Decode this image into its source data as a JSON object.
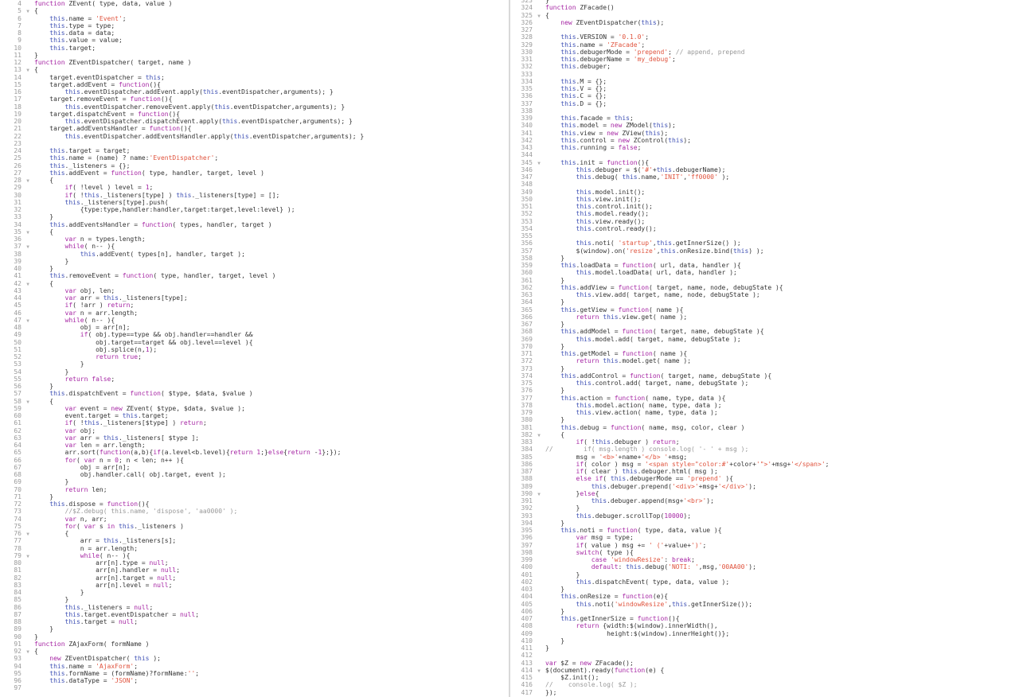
{
  "panes": [
    {
      "id": "left",
      "start": 0,
      "lines": [
        "4|function ZEvent( type, data, value )",
        "5|{",
        "6|    this.name = 'Event';",
        "7|    this.type = type;",
        "8|    this.data = data;",
        "9|    this.value = value;",
        "10|    this.target;",
        "11|}",
        "12|function ZEventDispatcher( target, name )",
        "13|{",
        "14|    target.eventDispatcher = this;",
        "15|    target.addEvent = function(){",
        "16|        this.eventDispatcher.addEvent.apply(this.eventDispatcher,arguments); }",
        "17|    target.removeEvent = function(){",
        "18|        this.eventDispatcher.removeEvent.apply(this.eventDispatcher,arguments); }",
        "19|    target.dispatchEvent = function(){",
        "20|        this.eventDispatcher.dispatchEvent.apply(this.eventDispatcher,arguments); }",
        "21|    target.addEventsHandler = function(){",
        "22|        this.eventDispatcher.addEventsHandler.apply(this.eventDispatcher,arguments); }",
        "23|",
        "24|    this.target = target;",
        "25|    this.name = (name) ? name:'EventDispatcher';",
        "26|    this._listeners = {};",
        "27|    this.addEvent = function( type, handler, target, level )",
        "28|    {",
        "29|        if( !level ) level = 1;",
        "30|        if( !this._listeners[type] ) this._listeners[type] = [];",
        "31|        this._listeners[type].push(",
        "32|            {type:type,handler:handler,target:target,level:level} );",
        "33|    }",
        "34|    this.addEventsHandler = function( types, handler, target )",
        "35|    {",
        "36|        var n = types.length;",
        "37|        while( n-- ){",
        "38|            this.addEvent( types[n], handler, target );",
        "39|        }",
        "40|    }",
        "41|    this.removeEvent = function( type, handler, target, level )",
        "42|    {",
        "43|        var obj, len;",
        "44|        var arr = this._listeners[type];",
        "45|        if( !arr ) return;",
        "46|        var n = arr.length;",
        "47|        while( n-- ){",
        "48|            obj = arr[n];",
        "49|            if( obj.type==type && obj.handler==handler &&",
        "50|                obj.target==target && obj.level==level ){",
        "51|                obj.splice(n,1);",
        "52|                return true;",
        "53|            }",
        "54|        }",
        "55|        return false;",
        "56|    }",
        "57|    this.dispatchEvent = function( $type, $data, $value )",
        "58|    {",
        "59|        var event = new ZEvent( $type, $data, $value );",
        "60|        event.target = this.target;",
        "61|        if( !this._listeners[$type] ) return;",
        "62|        var obj;",
        "63|        var arr = this._listeners[ $type ];",
        "64|        var len = arr.length;",
        "65|        arr.sort(function(a,b){if(a.level<b.level){return 1;}else{return -1};});",
        "66|        for( var n = 0; n < len; n++ ){",
        "67|            obj = arr[n];",
        "68|            obj.handler.call( obj.target, event );",
        "69|        }",
        "70|        return len;",
        "71|    }",
        "72|    this.dispose = function(){",
        "73|        //$Z.debug( this.name, 'dispose', 'aa0000' );",
        "74|        var n, arr;",
        "75|        for( var s in this._listeners )",
        "76|        {",
        "77|            arr = this._listeners[s];",
        "78|            n = arr.length;",
        "79|            while( n-- ){",
        "80|                arr[n].type = null;",
        "81|                arr[n].handler = null;",
        "82|                arr[n].target = null;",
        "83|                arr[n].level = null;",
        "84|            }",
        "85|        }",
        "86|        this._listeners = null;",
        "87|        this.target.eventDispatcher = null;",
        "88|        this.target = null;",
        "89|    }",
        "90|}",
        "91|function ZAjaxForm( formName )",
        "92|{",
        "93|    new ZEventDispatcher( this );",
        "94|    this.name = 'AjaxForm';",
        "95|    this.formName = (formName)?formName:'';",
        "96|    this.dataType = 'JSON';",
        "97|"
      ],
      "folds": [
        "5",
        "13",
        "28",
        "35",
        "37",
        "42",
        "47",
        "58",
        "76",
        "79",
        "92"
      ]
    },
    {
      "id": "right",
      "start": -4,
      "lines": [
        "323|}",
        "324|function ZFacade()",
        "325|{",
        "326|    new ZEventDispatcher(this);",
        "327|",
        "328|    this.VERSION = '0.1.0';",
        "329|    this.name = 'ZFacade';",
        "330|    this.debugerMode = 'prepend'; // append, prepend",
        "331|    this.debugerName = 'my_debug';",
        "332|    this.debuger;",
        "333|",
        "334|    this.M = {};",
        "335|    this.V = {};",
        "336|    this.C = {};",
        "337|    this.D = {};",
        "338|",
        "339|    this.facade = this;",
        "340|    this.model = new ZModel(this);",
        "341|    this.view = new ZView(this);",
        "342|    this.control = new ZControl(this);",
        "343|    this.running = false;",
        "344|",
        "345|    this.init = function(){",
        "346|        this.debuger = $('#'+this.debugerName);",
        "347|        this.debug( this.name,'INIT','ff0000' );",
        "348|",
        "349|        this.model.init();",
        "350|        this.view.init();",
        "351|        this.control.init();",
        "352|        this.model.ready();",
        "353|        this.view.ready();",
        "354|        this.control.ready();",
        "355|",
        "356|        this.noti( 'startup',this.getInnerSize() );",
        "357|        $(window).on('resize',this.onResize.bind(this) );",
        "358|    }",
        "359|    this.loadData = function( url, data, handler ){",
        "360|        this.model.loadData( url, data, handler );",
        "361|    }",
        "362|    this.addView = function( target, name, node, debugState ){",
        "363|        this.view.add( target, name, node, debugState );",
        "364|    }",
        "365|    this.getView = function( name ){",
        "366|        return this.view.get( name );",
        "367|    }",
        "368|    this.addModel = function( target, name, debugState ){",
        "369|        this.model.add( target, name, debugState );",
        "370|    }",
        "371|    this.getModel = function( name ){",
        "372|        return this.model.get( name );",
        "373|    }",
        "374|    this.addControl = function( target, name, debugState ){",
        "375|        this.control.add( target, name, debugState );",
        "376|    }",
        "377|    this.action = function( name, type, data ){",
        "378|        this.model.action( name, type, data );",
        "379|        this.view.action( name, type, data );",
        "380|    }",
        "381|    this.debug = function( name, msg, color, clear )",
        "382|    {",
        "383|        if( !this.debuger ) return;",
        "384|//        if( msg.length ) console.log( '- ' + msg );",
        "385|        msg = '<b>'+name+'</b> '+msg;",
        "386|        if( color ) msg = '<span style=\"color:#'+color+'\">'+msg+'</span>';",
        "387|        if( clear ) this.debuger.html( msg );",
        "388|        else if( this.debugerMode == 'prepend' ){",
        "389|            this.debuger.prepend('<div>'+msg+'</div>');",
        "390|        }else{",
        "391|            this.debuger.append(msg+'<br>');",
        "392|        }",
        "393|        this.debuger.scrollTop(10000);",
        "394|    }",
        "395|    this.noti = function( type, data, value ){",
        "396|        var msg = type;",
        "397|        if( value ) msg += ' ('+value+')';",
        "398|        switch( type ){",
        "399|            case 'windowResize': break;",
        "400|            default: this.debug('NOTI: ',msg,'00AA00');",
        "401|        }",
        "402|        this.dispatchEvent( type, data, value );",
        "403|    }",
        "404|    this.onResize = function(e){",
        "405|        this.noti('windowResize',this.getInnerSize());",
        "406|    }",
        "407|    this.getInnerSize = function(){",
        "408|        return {width:$(window).innerWidth(),",
        "409|                height:$(window).innerHeight()};",
        "410|    }",
        "411|}",
        "412|",
        "413|var $Z = new ZFacade();",
        "414|$(document).ready(function(e) {",
        "415|    $Z.init();",
        "416|//    console.log( $Z );",
        "417|});"
      ],
      "folds": [
        "325",
        "345",
        "382",
        "390",
        "414"
      ]
    }
  ]
}
